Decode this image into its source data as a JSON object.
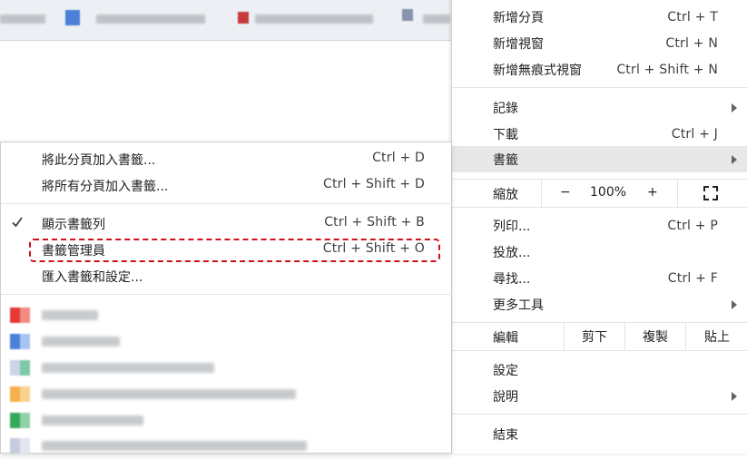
{
  "main_menu": {
    "items_top": [
      {
        "label": "新增分頁",
        "shortcut": "Ctrl + T"
      },
      {
        "label": "新增視窗",
        "shortcut": "Ctrl + N"
      },
      {
        "label": "新增無痕式視窗",
        "shortcut": "Ctrl + Shift + N"
      }
    ],
    "history": "記錄",
    "downloads": {
      "label": "下載",
      "shortcut": "Ctrl + J"
    },
    "bookmarks": "書籤",
    "zoom": {
      "label": "縮放",
      "minus": "−",
      "value": "100%",
      "plus": "+"
    },
    "print": {
      "label": "列印...",
      "shortcut": "Ctrl + P"
    },
    "cast": "投放...",
    "find": {
      "label": "尋找...",
      "shortcut": "Ctrl + F"
    },
    "more_tools": "更多工具",
    "edit": {
      "label": "編輯",
      "cut": "剪下",
      "copy": "複製",
      "paste": "貼上"
    },
    "settings": "設定",
    "help": "說明",
    "exit": "結束"
  },
  "submenu": {
    "bookmark_tab": {
      "label": "將此分頁加入書籤...",
      "shortcut": "Ctrl + D"
    },
    "bookmark_all": {
      "label": "將所有分頁加入書籤...",
      "shortcut": "Ctrl + Shift + D"
    },
    "show_bar": {
      "label": "顯示書籤列",
      "shortcut": "Ctrl + Shift + B"
    },
    "manager": {
      "label": "書籤管理員",
      "shortcut": "Ctrl + Shift + O"
    },
    "import": {
      "label": "匯入書籤和設定..."
    }
  },
  "colors": {
    "highlight_border": "#d0101a",
    "menu_hover": "#e8e8e8"
  }
}
